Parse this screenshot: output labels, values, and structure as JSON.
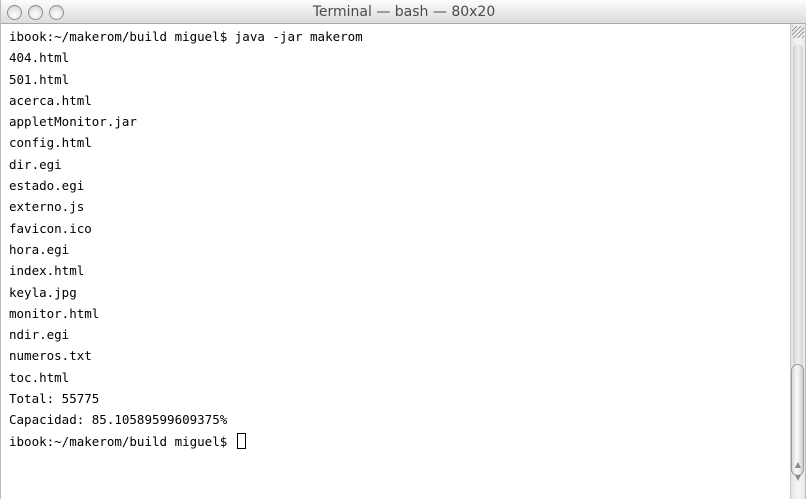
{
  "window": {
    "title": "Terminal — bash — 80x20"
  },
  "terminal": {
    "lines": [
      "ibook:~/makerom/build miguel$ java -jar makerom",
      "404.html",
      "501.html",
      "acerca.html",
      "appletMonitor.jar",
      "config.html",
      "dir.egi",
      "estado.egi",
      "externo.js",
      "favicon.ico",
      "hora.egi",
      "index.html",
      "keyla.jpg",
      "monitor.html",
      "ndir.egi",
      "numeros.txt",
      "toc.html",
      "Total: 55775",
      "Capacidad: 85.10589599609375%"
    ],
    "prompt": "ibook:~/makerom/build miguel$ "
  },
  "icons": {
    "close": "close-button-icon",
    "minimize": "minimize-button-icon",
    "zoom": "zoom-button-icon",
    "resize": "resize-grip-icon",
    "scroll_up": "scroll-up-arrow-icon",
    "scroll_down": "scroll-down-arrow-icon"
  }
}
